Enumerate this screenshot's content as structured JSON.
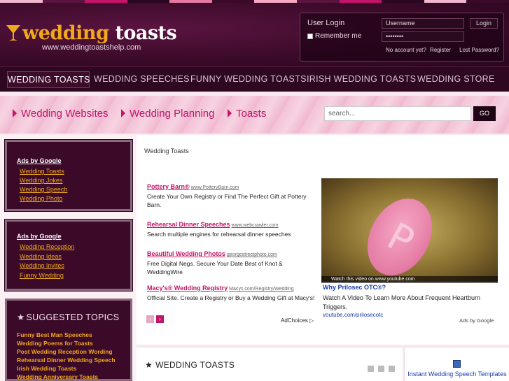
{
  "topstrip_colors": [
    "#f0b7cf",
    "#5a1440",
    "#c2146a",
    "#2a0620",
    "#e47aa4",
    "#3a0a28",
    "#f6a8c4",
    "#5a1440",
    "#c2146a",
    "#2a0620",
    "#f0b7cf",
    "#3a0a28"
  ],
  "logo": {
    "word1": "wedding",
    "word2": " toasts",
    "url": "www.weddingtoastshelp.com"
  },
  "login": {
    "title": "User Login",
    "remember": "Remember me",
    "username_placeholder": "Username",
    "password_value": "••••••••",
    "button": "Login",
    "no_account": "No account yet?",
    "register": "Register",
    "lost_password": "Lost Password?"
  },
  "nav": {
    "items": [
      {
        "label": "WEDDING TOASTS"
      },
      {
        "label": "WEDDING SPEECHES"
      },
      {
        "label": "FUNNY WEDDING TOASTS"
      },
      {
        "label": "IRISH WEDDING TOASTS"
      },
      {
        "label": "WEDDING STORE"
      }
    ]
  },
  "pinkbar": {
    "links": [
      {
        "label": "Wedding Websites"
      },
      {
        "label": "Wedding Planning"
      },
      {
        "label": "Toasts"
      }
    ],
    "search_placeholder": "search...",
    "search_button": "GO"
  },
  "sidebar": {
    "ad1": {
      "title": "Ads by Google",
      "links": [
        "Wedding Toasts",
        "Wedding Jokes",
        "Wedding Speech",
        "Wedding Photo"
      ]
    },
    "ad2": {
      "title": "Ads by Google",
      "links": [
        "Wedding Reception",
        "Wedding Ideas",
        "Wedding Invites",
        "Funny Wedding"
      ]
    },
    "topics": {
      "title": "SUGGESTED TOPICS",
      "items": [
        "Funny Best Man Speeches",
        "Wedding Poems for Toasts",
        "Post Wedding Reception Wording",
        "Rehearsal Dinner Wedding Speech",
        "Irish Wedding Toasts",
        "Wedding Anniversary Toasts"
      ]
    }
  },
  "main": {
    "breadcrumb": "Wedding Toasts",
    "ads": [
      {
        "title": "Pottery Barn®",
        "url": "www.PotteryBarn.com",
        "desc": "Create Your Own Registry or Find The Perfect Gift at Pottery Barn."
      },
      {
        "title": "Rehearsal Dinner Speeches",
        "url": "www.webcrawler.com",
        "desc": "Search multiple engines for rehearsal dinner speeches"
      },
      {
        "title": "Beautiful Wedding Photos",
        "url": "georgestreetphoto.com",
        "desc": "Free Digital Negs. Secure Your Date Best of Knot & WeddingWire"
      },
      {
        "title": "Macy's® Wedding Registry",
        "url": "Macys.com/Registry/Wedding",
        "desc": "Official Site. Create a Registry or Buy a Wedding Gift at Macy's!"
      }
    ],
    "adchoices": "AdChoices ▷",
    "ads_by_google": "Ads by Google",
    "video": {
      "bar_text": "Watch this video on www.youtube.com",
      "pill_letter": "P",
      "title": "Why Prilosec OTC®?",
      "desc": "Watch A Video To Learn More About Frequent Heartburn Triggers.",
      "url": "youtube.com/prilosecotc"
    }
  },
  "bottom": {
    "section_title": "WEDDING TOASTS",
    "right_link": "Instant Wedding Speech Templates"
  }
}
